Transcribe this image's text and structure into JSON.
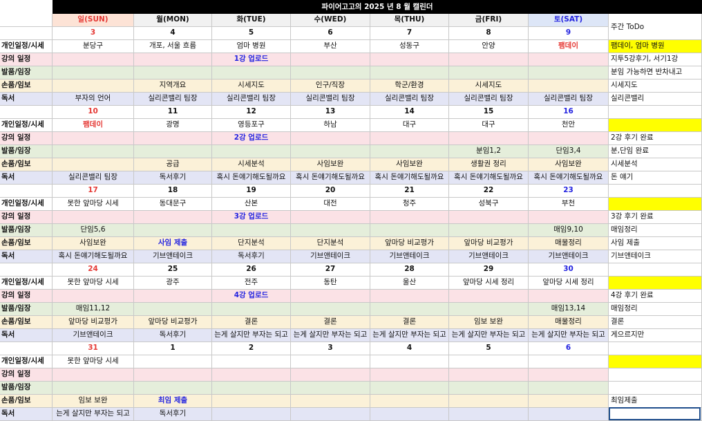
{
  "title": "파이어고고의 2025 년 8 월 캘린더",
  "todo_header": "주간 ToDo",
  "days": [
    {
      "label": "일(SUN)",
      "tone": "sun"
    },
    {
      "label": "월(MON)",
      "tone": "wk"
    },
    {
      "label": "화(TUE)",
      "tone": "wk"
    },
    {
      "label": "수(WED)",
      "tone": "wk"
    },
    {
      "label": "목(THU)",
      "tone": "wk"
    },
    {
      "label": "금(FRI)",
      "tone": "wk"
    },
    {
      "label": "토(SAT)",
      "tone": "sat"
    }
  ],
  "row_labels": [
    "개인일정/시세",
    "강의 일정",
    "발품/임장",
    "손품/임보",
    "독서"
  ],
  "colors": {
    "sun_bg": "#fde3d6",
    "wk_bg": "#f1f1f1",
    "sat_bg": "#dde6f7",
    "personal_bg": "#ffffff",
    "lecture_bg": "#fbe2e6",
    "field_bg": "#e5eedb",
    "analysis_bg": "#fbf1d8",
    "reading_bg": "#e3e5f5",
    "todo_highlight": "#ffff00",
    "sun_red": "#e53935",
    "sat_blue": "#2323e0"
  },
  "weeks": [
    {
      "dates": [
        "3",
        "4",
        "5",
        "6",
        "7",
        "8",
        "9"
      ],
      "personal": [
        {
          "t": "분당구"
        },
        {
          "t": "개포, 서울 흐름"
        },
        {
          "t": "엄마 병원"
        },
        {
          "t": "부산"
        },
        {
          "t": "성동구"
        },
        {
          "t": "안양"
        },
        {
          "t": "팸데이",
          "s": "red"
        }
      ],
      "lecture": [
        {
          "t": ""
        },
        {
          "t": ""
        },
        {
          "t": "1강 업로드",
          "s": "blue"
        },
        {
          "t": ""
        },
        {
          "t": ""
        },
        {
          "t": ""
        },
        {
          "t": ""
        }
      ],
      "field": [
        {
          "t": ""
        },
        {
          "t": ""
        },
        {
          "t": ""
        },
        {
          "t": ""
        },
        {
          "t": ""
        },
        {
          "t": ""
        },
        {
          "t": ""
        }
      ],
      "analysis": [
        {
          "t": ""
        },
        {
          "t": "지역개요"
        },
        {
          "t": "시세지도"
        },
        {
          "t": "인구/직장"
        },
        {
          "t": "학군/환경"
        },
        {
          "t": "시세지도"
        },
        {
          "t": ""
        }
      ],
      "reading": [
        {
          "t": "부자의 언어"
        },
        {
          "t": "실리콘밸리 팀장"
        },
        {
          "t": "실리콘밸리 팀장"
        },
        {
          "t": "실리콘밸리 팀장"
        },
        {
          "t": "실리콘밸리 팀장"
        },
        {
          "t": "실리콘밸리 팀장"
        },
        {
          "t": "실리콘밸리 팀장"
        }
      ],
      "todo": {
        "personal": "팸데이, 엄마 병원",
        "personal_hl": true,
        "lecture": "지투5강후기, 서기1강",
        "field": "분임 가능하면 반차내고",
        "analysis": "시세지도",
        "reading": "실리콘밸리"
      }
    },
    {
      "dates": [
        "10",
        "11",
        "12",
        "13",
        "14",
        "15",
        "16"
      ],
      "personal": [
        {
          "t": "팸데이",
          "s": "red"
        },
        {
          "t": "광명"
        },
        {
          "t": "영등포구"
        },
        {
          "t": "하남"
        },
        {
          "t": "대구"
        },
        {
          "t": "대구"
        },
        {
          "t": "천안"
        }
      ],
      "lecture": [
        {
          "t": ""
        },
        {
          "t": ""
        },
        {
          "t": "2강 업로드",
          "s": "blue"
        },
        {
          "t": ""
        },
        {
          "t": ""
        },
        {
          "t": ""
        },
        {
          "t": ""
        }
      ],
      "field": [
        {
          "t": ""
        },
        {
          "t": ""
        },
        {
          "t": ""
        },
        {
          "t": ""
        },
        {
          "t": ""
        },
        {
          "t": "분임1,2"
        },
        {
          "t": "단임3,4"
        }
      ],
      "analysis": [
        {
          "t": ""
        },
        {
          "t": "공급"
        },
        {
          "t": "시세분석"
        },
        {
          "t": "사임보완"
        },
        {
          "t": "사임보완"
        },
        {
          "t": "생활권 정리"
        },
        {
          "t": "사임보완"
        }
      ],
      "reading": [
        {
          "t": "실리콘밸리 팀장"
        },
        {
          "t": "독서후기"
        },
        {
          "t": "혹시 돈얘기해도될까요"
        },
        {
          "t": "혹시 돈얘기해도될까요"
        },
        {
          "t": "혹시 돈얘기해도될까요"
        },
        {
          "t": "혹시 돈얘기해도될까요"
        },
        {
          "t": "혹시 돈얘기해도될까요"
        }
      ],
      "todo": {
        "personal": "",
        "personal_hl": true,
        "lecture": "2강 후기 완료",
        "field": "분,단임 완료",
        "analysis": "시세분석",
        "reading": "돈 얘기"
      }
    },
    {
      "dates": [
        "17",
        "18",
        "19",
        "20",
        "21",
        "22",
        "23"
      ],
      "personal": [
        {
          "t": "못한 앞마당 시세"
        },
        {
          "t": "동대문구"
        },
        {
          "t": "산본"
        },
        {
          "t": "대전"
        },
        {
          "t": "청주"
        },
        {
          "t": "성북구"
        },
        {
          "t": "부천"
        }
      ],
      "lecture": [
        {
          "t": ""
        },
        {
          "t": ""
        },
        {
          "t": "3강 업로드",
          "s": "blue"
        },
        {
          "t": ""
        },
        {
          "t": ""
        },
        {
          "t": ""
        },
        {
          "t": ""
        }
      ],
      "field": [
        {
          "t": "단임5,6"
        },
        {
          "t": ""
        },
        {
          "t": ""
        },
        {
          "t": ""
        },
        {
          "t": ""
        },
        {
          "t": ""
        },
        {
          "t": "매임9,10"
        }
      ],
      "analysis": [
        {
          "t": "사임보완"
        },
        {
          "t": "사임 제출",
          "s": "blue"
        },
        {
          "t": "단지분석"
        },
        {
          "t": "단지분석"
        },
        {
          "t": "앞마당 비교평가"
        },
        {
          "t": "앞마당 비교평가"
        },
        {
          "t": "매물정리"
        }
      ],
      "reading": [
        {
          "t": "혹시 돈얘기해도될까요"
        },
        {
          "t": "기브앤테이크"
        },
        {
          "t": "독서후기"
        },
        {
          "t": "기브앤테이크"
        },
        {
          "t": "기브앤테이크"
        },
        {
          "t": "기브앤테이크"
        },
        {
          "t": "기브앤테이크"
        }
      ],
      "todo": {
        "personal": "",
        "personal_hl": true,
        "lecture": "3강 후기 완료",
        "field": "매임정리",
        "analysis": "사임 제출",
        "reading": "기브앤테이크"
      }
    },
    {
      "dates": [
        "24",
        "25",
        "26",
        "27",
        "28",
        "29",
        "30"
      ],
      "personal": [
        {
          "t": "못한 앞마당 시세"
        },
        {
          "t": "광주"
        },
        {
          "t": "전주"
        },
        {
          "t": "동탄"
        },
        {
          "t": "울산"
        },
        {
          "t": "앞마당 시세 정리"
        },
        {
          "t": "앞마당 시세 정리"
        }
      ],
      "lecture": [
        {
          "t": ""
        },
        {
          "t": ""
        },
        {
          "t": "4강 업로드",
          "s": "blue"
        },
        {
          "t": ""
        },
        {
          "t": ""
        },
        {
          "t": ""
        },
        {
          "t": ""
        }
      ],
      "field": [
        {
          "t": "매임11,12"
        },
        {
          "t": ""
        },
        {
          "t": ""
        },
        {
          "t": ""
        },
        {
          "t": ""
        },
        {
          "t": ""
        },
        {
          "t": "매임13,14"
        }
      ],
      "analysis": [
        {
          "t": "앞마당 비교평가"
        },
        {
          "t": "앞마당 비교평가"
        },
        {
          "t": "결론"
        },
        {
          "t": "결론"
        },
        {
          "t": "결론"
        },
        {
          "t": "임보 보완"
        },
        {
          "t": "매물정리"
        }
      ],
      "reading": [
        {
          "t": "기브앤테이크"
        },
        {
          "t": "독서후기"
        },
        {
          "t": "는게 살지만 부자는 되고"
        },
        {
          "t": "는게 살지만 부자는 되고"
        },
        {
          "t": "는게 살지만 부자는 되고"
        },
        {
          "t": "는게 살지만 부자는 되고"
        },
        {
          "t": "는게 살지만 부자는 되고"
        }
      ],
      "todo": {
        "personal": "",
        "personal_hl": true,
        "lecture": "4강 후기 완료",
        "field": "매임정리",
        "analysis": "결론",
        "reading": "게으르지만"
      }
    },
    {
      "dates": [
        "31",
        "1",
        "2",
        "3",
        "4",
        "5",
        "6"
      ],
      "personal": [
        {
          "t": "못한 앞마당 시세"
        },
        {
          "t": ""
        },
        {
          "t": ""
        },
        {
          "t": ""
        },
        {
          "t": ""
        },
        {
          "t": ""
        },
        {
          "t": ""
        }
      ],
      "lecture": [
        {
          "t": ""
        },
        {
          "t": ""
        },
        {
          "t": ""
        },
        {
          "t": ""
        },
        {
          "t": ""
        },
        {
          "t": ""
        },
        {
          "t": ""
        }
      ],
      "field": [
        {
          "t": ""
        },
        {
          "t": ""
        },
        {
          "t": ""
        },
        {
          "t": ""
        },
        {
          "t": ""
        },
        {
          "t": ""
        },
        {
          "t": ""
        }
      ],
      "analysis": [
        {
          "t": "임보 보완"
        },
        {
          "t": "최임 제출",
          "s": "blue"
        },
        {
          "t": ""
        },
        {
          "t": ""
        },
        {
          "t": ""
        },
        {
          "t": ""
        },
        {
          "t": ""
        }
      ],
      "reading": [
        {
          "t": "는게 살지만 부자는 되고"
        },
        {
          "t": "독서후기"
        },
        {
          "t": ""
        },
        {
          "t": ""
        },
        {
          "t": ""
        },
        {
          "t": ""
        },
        {
          "t": ""
        }
      ],
      "todo": {
        "personal": "",
        "personal_hl": true,
        "lecture": "",
        "field": "",
        "analysis": "최임제출",
        "reading": ""
      }
    }
  ]
}
